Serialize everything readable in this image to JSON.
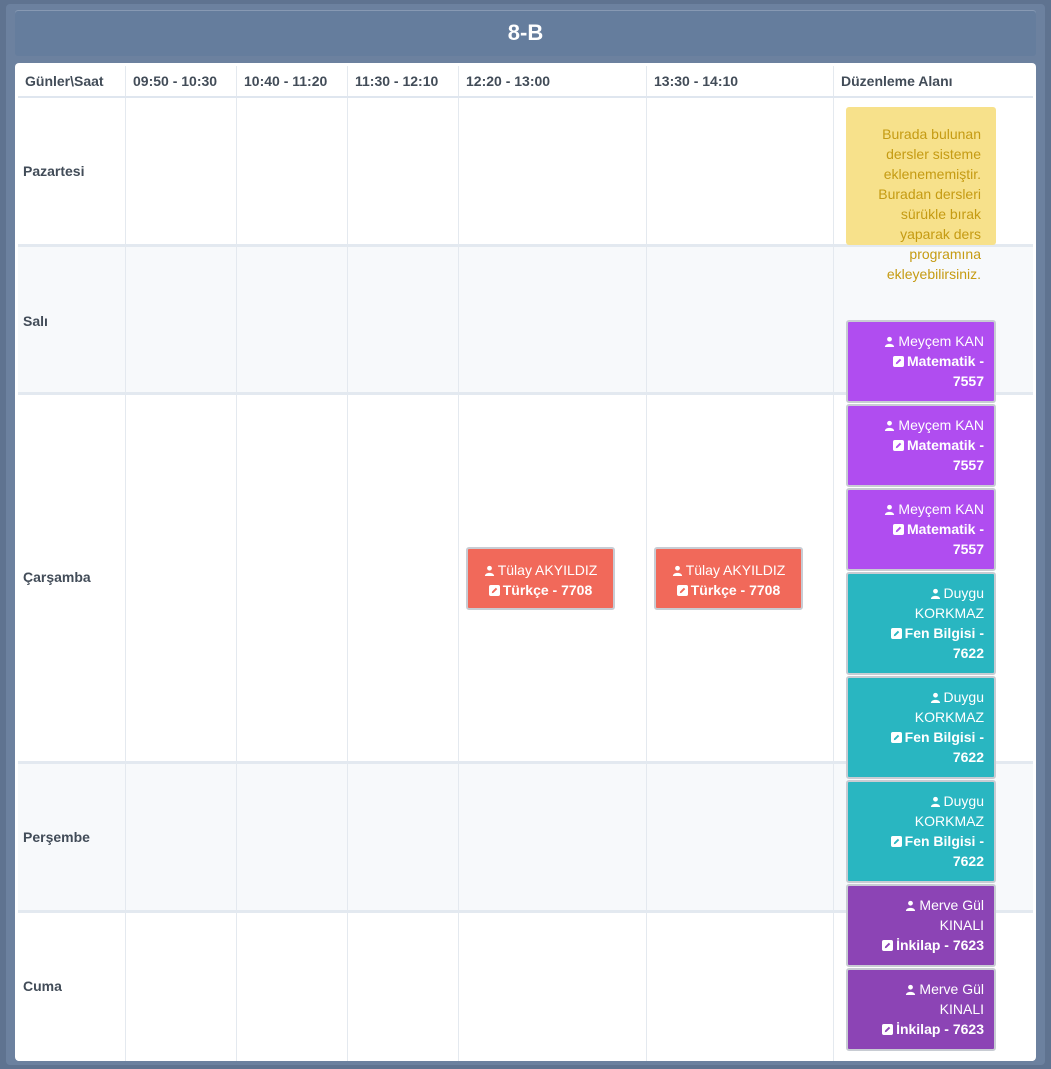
{
  "title": "8-B",
  "headers": [
    "Günler\\Saat",
    "09:50 - 10:30",
    "10:40 - 11:20",
    "11:30 - 12:10",
    "12:20 - 13:00",
    "13:30 - 14:10",
    "Düzenleme Alanı"
  ],
  "days": [
    "Pazartesi",
    "Salı",
    "Çarşamba",
    "Perşembe",
    "Cuma"
  ],
  "notice": "Burada bulunan dersler sisteme eklenememiştir. Buradan dersleri sürükle bırak yaparak ders programına ekleyebilirsiniz.",
  "scheduled": [
    {
      "teacher": "Tülay AKYILDIZ",
      "subject": "Türkçe - 7708",
      "day": "Çarşamba",
      "slot": "12:20 - 13:00"
    },
    {
      "teacher": "Tülay AKYILDIZ",
      "subject": "Türkçe - 7708",
      "day": "Çarşamba",
      "slot": "13:30 - 14:10"
    }
  ],
  "unplaced": [
    {
      "teacher": "Meyçem KAN",
      "subject": "Matematik - 7557"
    },
    {
      "teacher": "Meyçem KAN",
      "subject": "Matematik - 7557"
    },
    {
      "teacher": "Meyçem KAN",
      "subject": "Matematik - 7557"
    },
    {
      "teacher": "Duygu KORKMAZ",
      "subject": "Fen Bilgisi - 7622"
    },
    {
      "teacher": "Duygu KORKMAZ",
      "subject": "Fen Bilgisi - 7622"
    },
    {
      "teacher": "Duygu KORKMAZ",
      "subject": "Fen Bilgisi - 7622"
    },
    {
      "teacher": "Merve Gül KINALI",
      "subject": "İnkilap - 7623"
    },
    {
      "teacher": "Merve Gül KINALI",
      "subject": "İnkilap - 7623"
    }
  ],
  "colors": {
    "matematik": "#b04df0",
    "fen": "#29b6c1",
    "inkilap": "#8c44b5",
    "turkce": "#f1695a",
    "notice_bg": "#f7e18b",
    "notice_text": "#c59b13"
  },
  "icons": {
    "teacher": "user-icon",
    "subject": "edit-icon"
  }
}
